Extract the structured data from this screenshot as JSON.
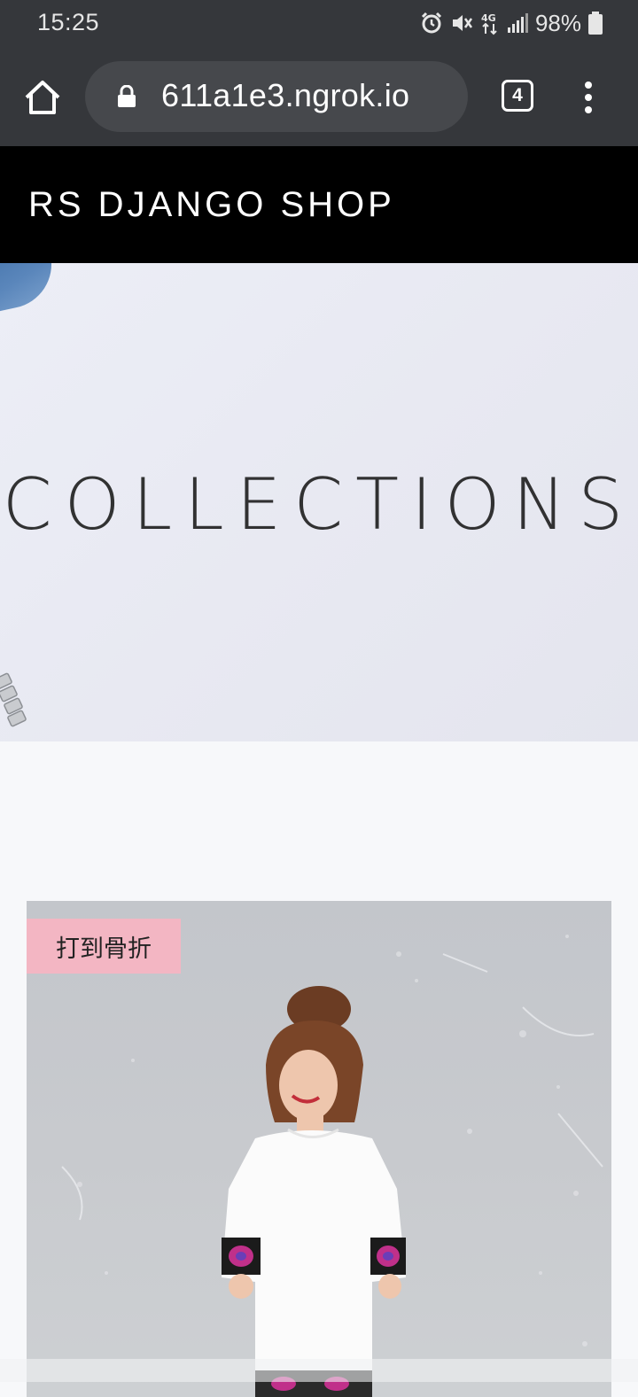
{
  "status_bar": {
    "time": "15:25",
    "network": "4G",
    "battery": "98%"
  },
  "browser": {
    "url": "611a1e3.ngrok.io",
    "tab_count": "4"
  },
  "site": {
    "title": "RS DJANGO SHOP"
  },
  "hero": {
    "title": "COLLECTIONS"
  },
  "product": {
    "badge": "打到骨折"
  },
  "colors": {
    "chrome": "#35373b",
    "url_box": "#46484c",
    "header_bg": "#000000",
    "badge_bg": "#f3b6c3"
  }
}
